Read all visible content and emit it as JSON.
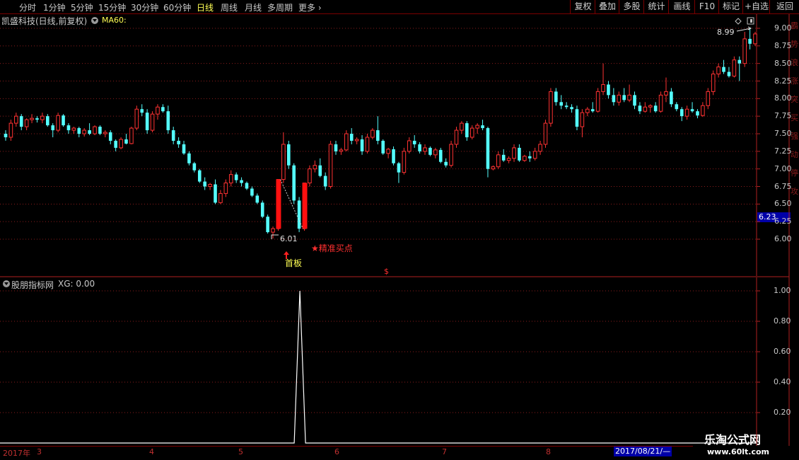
{
  "toolbar": {
    "periods": [
      "分时",
      "1分钟",
      "5分钟",
      "15分钟",
      "30分钟",
      "60分钟",
      "日线",
      "周线",
      "月线",
      "多周期",
      "更多"
    ],
    "active_period": "日线",
    "right_buttons": [
      "复权",
      "叠加",
      "多股",
      "统计",
      "画线",
      "F10",
      "标记",
      "+自选",
      "返回"
    ]
  },
  "main_chart": {
    "title": "凯盛科技(日线,前复权)",
    "indicator_label": "MA60:",
    "price_axis": [
      "9.00",
      "8.75",
      "8.50",
      "8.25",
      "8.00",
      "7.75",
      "7.50",
      "7.25",
      "7.00",
      "6.75",
      "6.50",
      "6.25",
      "6.00"
    ],
    "current_price": "6.23",
    "low_label": "6.01",
    "high_label": "8.99",
    "first_board_label": "首板",
    "buy_point_label": "★精准买点",
    "dollar_marker": "$"
  },
  "sub_chart": {
    "title": "股朋指标网",
    "xg_label": "XG: 0.00",
    "value_axis": [
      "1.00",
      "0.80",
      "0.60",
      "0.40",
      "0.20"
    ]
  },
  "date_axis": {
    "year": "2017年",
    "months": [
      "3",
      "4",
      "5",
      "6",
      "7",
      "8"
    ],
    "current_date": "2017/08/21/—"
  },
  "watermark": {
    "title": "乐淘公式网",
    "url": "www.60lt.com"
  },
  "colors": {
    "up": "#ff3232",
    "down": "#54ffff",
    "grid": "#8a1c1c",
    "highlight": "#ffff54"
  },
  "chart_data": {
    "type": "candlestick",
    "ylim": [
      5.75,
      9.2
    ],
    "ohlc": [
      [
        7.5,
        7.55,
        7.4,
        7.45
      ],
      [
        7.45,
        7.7,
        7.4,
        7.65
      ],
      [
        7.65,
        7.8,
        7.6,
        7.75
      ],
      [
        7.75,
        7.78,
        7.55,
        7.6
      ],
      [
        7.6,
        7.72,
        7.55,
        7.7
      ],
      [
        7.7,
        7.78,
        7.65,
        7.72
      ],
      [
        7.72,
        7.75,
        7.66,
        7.7
      ],
      [
        7.7,
        7.8,
        7.65,
        7.75
      ],
      [
        7.75,
        7.78,
        7.6,
        7.62
      ],
      [
        7.62,
        7.65,
        7.45,
        7.55
      ],
      [
        7.55,
        7.8,
        7.52,
        7.76
      ],
      [
        7.76,
        7.78,
        7.6,
        7.62
      ],
      [
        7.62,
        7.65,
        7.5,
        7.55
      ],
      [
        7.55,
        7.6,
        7.5,
        7.58
      ],
      [
        7.58,
        7.6,
        7.45,
        7.5
      ],
      [
        7.5,
        7.58,
        7.46,
        7.55
      ],
      [
        7.55,
        7.65,
        7.48,
        7.5
      ],
      [
        7.5,
        7.62,
        7.48,
        7.6
      ],
      [
        7.6,
        7.62,
        7.48,
        7.5
      ],
      [
        7.5,
        7.55,
        7.45,
        7.52
      ],
      [
        7.52,
        7.55,
        7.35,
        7.4
      ],
      [
        7.4,
        7.42,
        7.25,
        7.3
      ],
      [
        7.3,
        7.45,
        7.28,
        7.42
      ],
      [
        7.42,
        7.5,
        7.35,
        7.36
      ],
      [
        7.36,
        7.6,
        7.35,
        7.58
      ],
      [
        7.58,
        7.9,
        7.55,
        7.85
      ],
      [
        7.85,
        7.92,
        7.75,
        7.8
      ],
      [
        7.8,
        7.85,
        7.5,
        7.55
      ],
      [
        7.55,
        7.82,
        7.52,
        7.78
      ],
      [
        7.78,
        7.92,
        7.7,
        7.88
      ],
      [
        7.88,
        7.92,
        7.8,
        7.82
      ],
      [
        7.82,
        7.9,
        7.5,
        7.55
      ],
      [
        7.55,
        7.6,
        7.35,
        7.4
      ],
      [
        7.4,
        7.45,
        7.3,
        7.35
      ],
      [
        7.35,
        7.4,
        7.2,
        7.22
      ],
      [
        7.22,
        7.25,
        7.05,
        7.08
      ],
      [
        7.08,
        7.1,
        6.95,
        6.98
      ],
      [
        6.98,
        7.0,
        6.8,
        6.82
      ],
      [
        6.82,
        6.88,
        6.7,
        6.75
      ],
      [
        6.75,
        6.8,
        6.7,
        6.78
      ],
      [
        6.78,
        6.85,
        6.5,
        6.52
      ],
      [
        6.52,
        6.7,
        6.5,
        6.65
      ],
      [
        6.65,
        6.85,
        6.6,
        6.8
      ],
      [
        6.8,
        6.98,
        6.75,
        6.92
      ],
      [
        6.92,
        6.95,
        6.8,
        6.84
      ],
      [
        6.84,
        6.88,
        6.75,
        6.8
      ],
      [
        6.8,
        6.82,
        6.7,
        6.72
      ],
      [
        6.72,
        6.75,
        6.6,
        6.62
      ],
      [
        6.62,
        6.65,
        6.5,
        6.52
      ],
      [
        6.52,
        6.55,
        6.3,
        6.32
      ],
      [
        6.32,
        6.35,
        6.08,
        6.1
      ],
      [
        6.1,
        6.18,
        6.01,
        6.15
      ],
      [
        6.15,
        6.85,
        6.12,
        6.85
      ],
      [
        6.85,
        7.52,
        6.8,
        7.35
      ],
      [
        7.35,
        7.4,
        7.0,
        7.05
      ],
      [
        7.05,
        7.08,
        6.5,
        6.55
      ],
      [
        6.55,
        6.6,
        6.1,
        6.15
      ],
      [
        6.15,
        6.8,
        6.12,
        6.8
      ],
      [
        6.8,
        7.05,
        6.75,
        7.0
      ],
      [
        7.0,
        7.12,
        6.95,
        7.05
      ],
      [
        7.05,
        7.15,
        6.88,
        6.9
      ],
      [
        6.9,
        6.95,
        6.7,
        6.75
      ],
      [
        6.75,
        7.4,
        6.72,
        7.35
      ],
      [
        7.35,
        7.4,
        7.2,
        7.25
      ],
      [
        7.25,
        7.3,
        7.2,
        7.27
      ],
      [
        7.27,
        7.55,
        7.25,
        7.5
      ],
      [
        7.5,
        7.58,
        7.35,
        7.4
      ],
      [
        7.4,
        7.45,
        7.35,
        7.42
      ],
      [
        7.42,
        7.48,
        7.2,
        7.25
      ],
      [
        7.25,
        7.5,
        7.22,
        7.45
      ],
      [
        7.45,
        7.58,
        7.42,
        7.55
      ],
      [
        7.55,
        7.75,
        7.35,
        7.4
      ],
      [
        7.4,
        7.42,
        7.2,
        7.22
      ],
      [
        7.22,
        7.3,
        7.15,
        7.28
      ],
      [
        7.28,
        7.32,
        7.05,
        7.08
      ],
      [
        7.08,
        7.1,
        6.8,
        6.95
      ],
      [
        6.95,
        7.3,
        6.92,
        7.25
      ],
      [
        7.25,
        7.45,
        7.22,
        7.4
      ],
      [
        7.4,
        7.48,
        7.3,
        7.35
      ],
      [
        7.35,
        7.38,
        7.22,
        7.25
      ],
      [
        7.25,
        7.35,
        7.2,
        7.3
      ],
      [
        7.3,
        7.32,
        7.18,
        7.2
      ],
      [
        7.2,
        7.3,
        7.15,
        7.27
      ],
      [
        7.27,
        7.3,
        7.08,
        7.1
      ],
      [
        7.1,
        7.15,
        7.02,
        7.05
      ],
      [
        7.05,
        7.4,
        7.02,
        7.35
      ],
      [
        7.35,
        7.6,
        7.3,
        7.55
      ],
      [
        7.55,
        7.68,
        7.5,
        7.65
      ],
      [
        7.65,
        7.68,
        7.4,
        7.45
      ],
      [
        7.45,
        7.62,
        7.42,
        7.58
      ],
      [
        7.58,
        7.65,
        7.5,
        7.62
      ],
      [
        7.62,
        7.7,
        7.55,
        7.58
      ],
      [
        7.58,
        7.6,
        6.88,
        7.0
      ],
      [
        7.0,
        7.05,
        6.98,
        7.03
      ],
      [
        7.03,
        7.25,
        7.0,
        7.2
      ],
      [
        7.2,
        7.28,
        7.1,
        7.12
      ],
      [
        7.12,
        7.18,
        7.08,
        7.15
      ],
      [
        7.15,
        7.35,
        7.1,
        7.3
      ],
      [
        7.3,
        7.35,
        7.1,
        7.12
      ],
      [
        7.12,
        7.2,
        7.1,
        7.18
      ],
      [
        7.18,
        7.25,
        7.1,
        7.15
      ],
      [
        7.15,
        7.3,
        7.12,
        7.25
      ],
      [
        7.25,
        7.4,
        7.2,
        7.35
      ],
      [
        7.35,
        7.7,
        7.3,
        7.65
      ],
      [
        7.65,
        8.15,
        7.6,
        8.1
      ],
      [
        8.1,
        8.15,
        7.9,
        7.95
      ],
      [
        7.95,
        8.05,
        7.85,
        7.9
      ],
      [
        7.9,
        7.95,
        7.85,
        7.88
      ],
      [
        7.88,
        7.92,
        7.8,
        7.85
      ],
      [
        7.85,
        7.9,
        7.55,
        7.6
      ],
      [
        7.6,
        7.85,
        7.45,
        7.8
      ],
      [
        7.8,
        7.88,
        7.75,
        7.85
      ],
      [
        7.85,
        7.95,
        7.8,
        7.82
      ],
      [
        7.82,
        8.15,
        7.8,
        8.1
      ],
      [
        8.1,
        8.5,
        8.05,
        8.2
      ],
      [
        8.2,
        8.25,
        8.0,
        8.05
      ],
      [
        8.05,
        8.15,
        7.9,
        7.95
      ],
      [
        7.95,
        8.1,
        7.9,
        8.05
      ],
      [
        8.05,
        8.15,
        7.95,
        7.98
      ],
      [
        7.98,
        8.2,
        7.95,
        8.05
      ],
      [
        8.05,
        8.1,
        7.85,
        7.9
      ],
      [
        7.9,
        7.95,
        7.78,
        7.82
      ],
      [
        7.82,
        7.95,
        7.8,
        7.88
      ],
      [
        7.88,
        7.92,
        7.8,
        7.9
      ],
      [
        7.9,
        7.95,
        7.8,
        7.82
      ],
      [
        7.82,
        8.1,
        7.8,
        8.05
      ],
      [
        8.05,
        8.3,
        7.95,
        8.1
      ],
      [
        8.1,
        8.15,
        7.88,
        7.92
      ],
      [
        7.92,
        7.95,
        7.82,
        7.85
      ],
      [
        7.85,
        7.88,
        7.68,
        7.75
      ],
      [
        7.75,
        7.9,
        7.7,
        7.85
      ],
      [
        7.85,
        7.95,
        7.8,
        7.82
      ],
      [
        7.82,
        7.85,
        7.72,
        7.76
      ],
      [
        7.76,
        7.95,
        7.74,
        7.9
      ],
      [
        7.9,
        8.15,
        7.85,
        8.1
      ],
      [
        8.1,
        8.4,
        8.05,
        8.35
      ],
      [
        8.35,
        8.5,
        8.3,
        8.45
      ],
      [
        8.45,
        8.55,
        8.35,
        8.38
      ],
      [
        8.38,
        8.45,
        8.3,
        8.32
      ],
      [
        8.32,
        8.6,
        8.3,
        8.55
      ],
      [
        8.55,
        8.6,
        8.25,
        8.5
      ],
      [
        8.5,
        8.95,
        8.45,
        8.85
      ],
      [
        8.85,
        8.99,
        8.7,
        8.78
      ],
      [
        8.78,
        8.95,
        8.75,
        8.92
      ]
    ],
    "indicator": {
      "name": "XG",
      "pulse_index": 56,
      "pulse_value": 1.0,
      "ylim": [
        0,
        1.05
      ]
    }
  }
}
